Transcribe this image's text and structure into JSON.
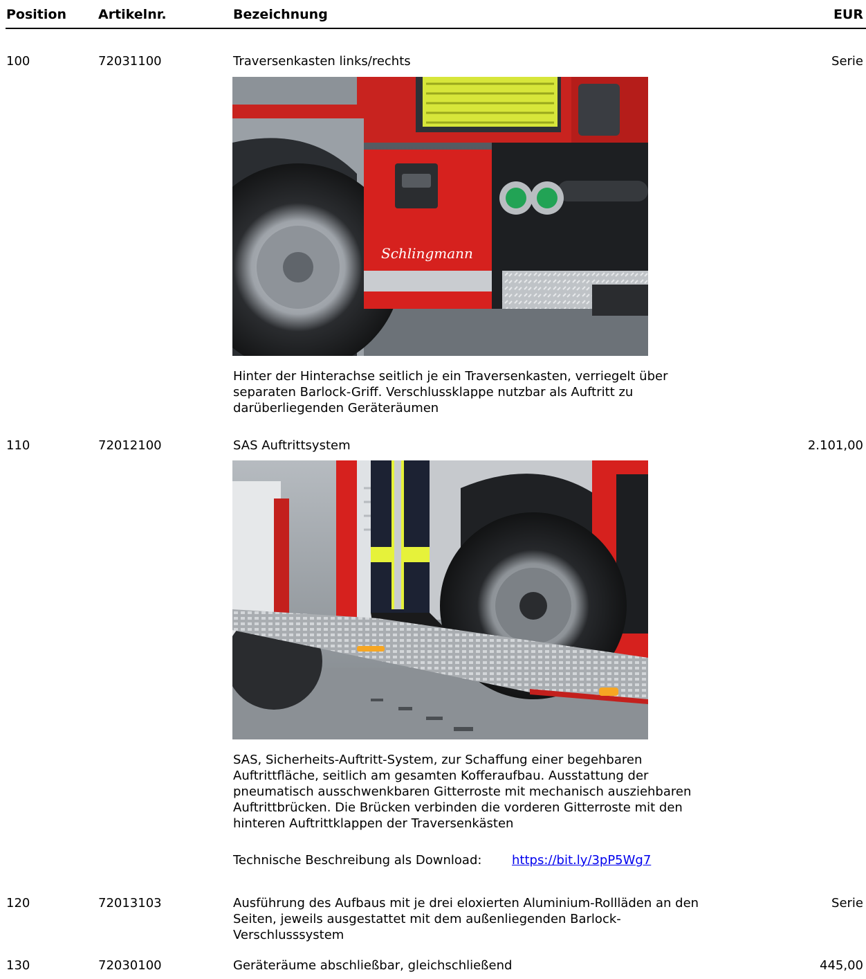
{
  "header": {
    "position": "Position",
    "artikelnr": "Artikelnr.",
    "bezeichnung": "Bezeichnung",
    "eur": "EUR"
  },
  "rows": [
    {
      "position": "100",
      "artikelnr": "72031100",
      "title": "Traversenkasten links/rechts",
      "price": "Serie",
      "description": "Hinter der Hinterachse seitlich je ein Traversenkasten, verriegelt über separaten Barlock-Griff. Verschlussklappe nutzbar als Auftritt zu darüberliegenden Geräteräumen",
      "image": {
        "brand_text": "Schlingmann"
      }
    },
    {
      "position": "110",
      "artikelnr": "72012100",
      "title": "SAS Auftrittsystem",
      "price": "2.101,00",
      "description": "SAS, Sicherheits-Auftritt-System, zur Schaffung einer begehbaren Auftrittfläche, seitlich am gesamten Kofferaufbau. Ausstattung der pneumatisch ausschwenkbaren Gitterroste mit mechanisch ausziehbaren Auftrittbrücken. Die Brücken verbinden die vorderen Gitterroste mit den hinteren Auftrittklappen der Traversenkästen",
      "download_label": "Technische Beschreibung als Download:",
      "download_link": "https://bit.ly/3pP5Wg7"
    },
    {
      "position": "120",
      "artikelnr": "72013103",
      "description": "Ausführung des Aufbaus mit je drei eloxierten Aluminium-Rollläden an den Seiten, jeweils ausgestattet mit dem außenliegenden Barlock-Verschlusssystem",
      "price": "Serie"
    },
    {
      "position": "130",
      "artikelnr": "72030100",
      "title": "Geräteräume abschließbar, gleichschließend",
      "price": "445,00"
    }
  ],
  "colors": {
    "text": "#000000",
    "link": "#0000ee",
    "vehicle_red": "#d6211e"
  }
}
